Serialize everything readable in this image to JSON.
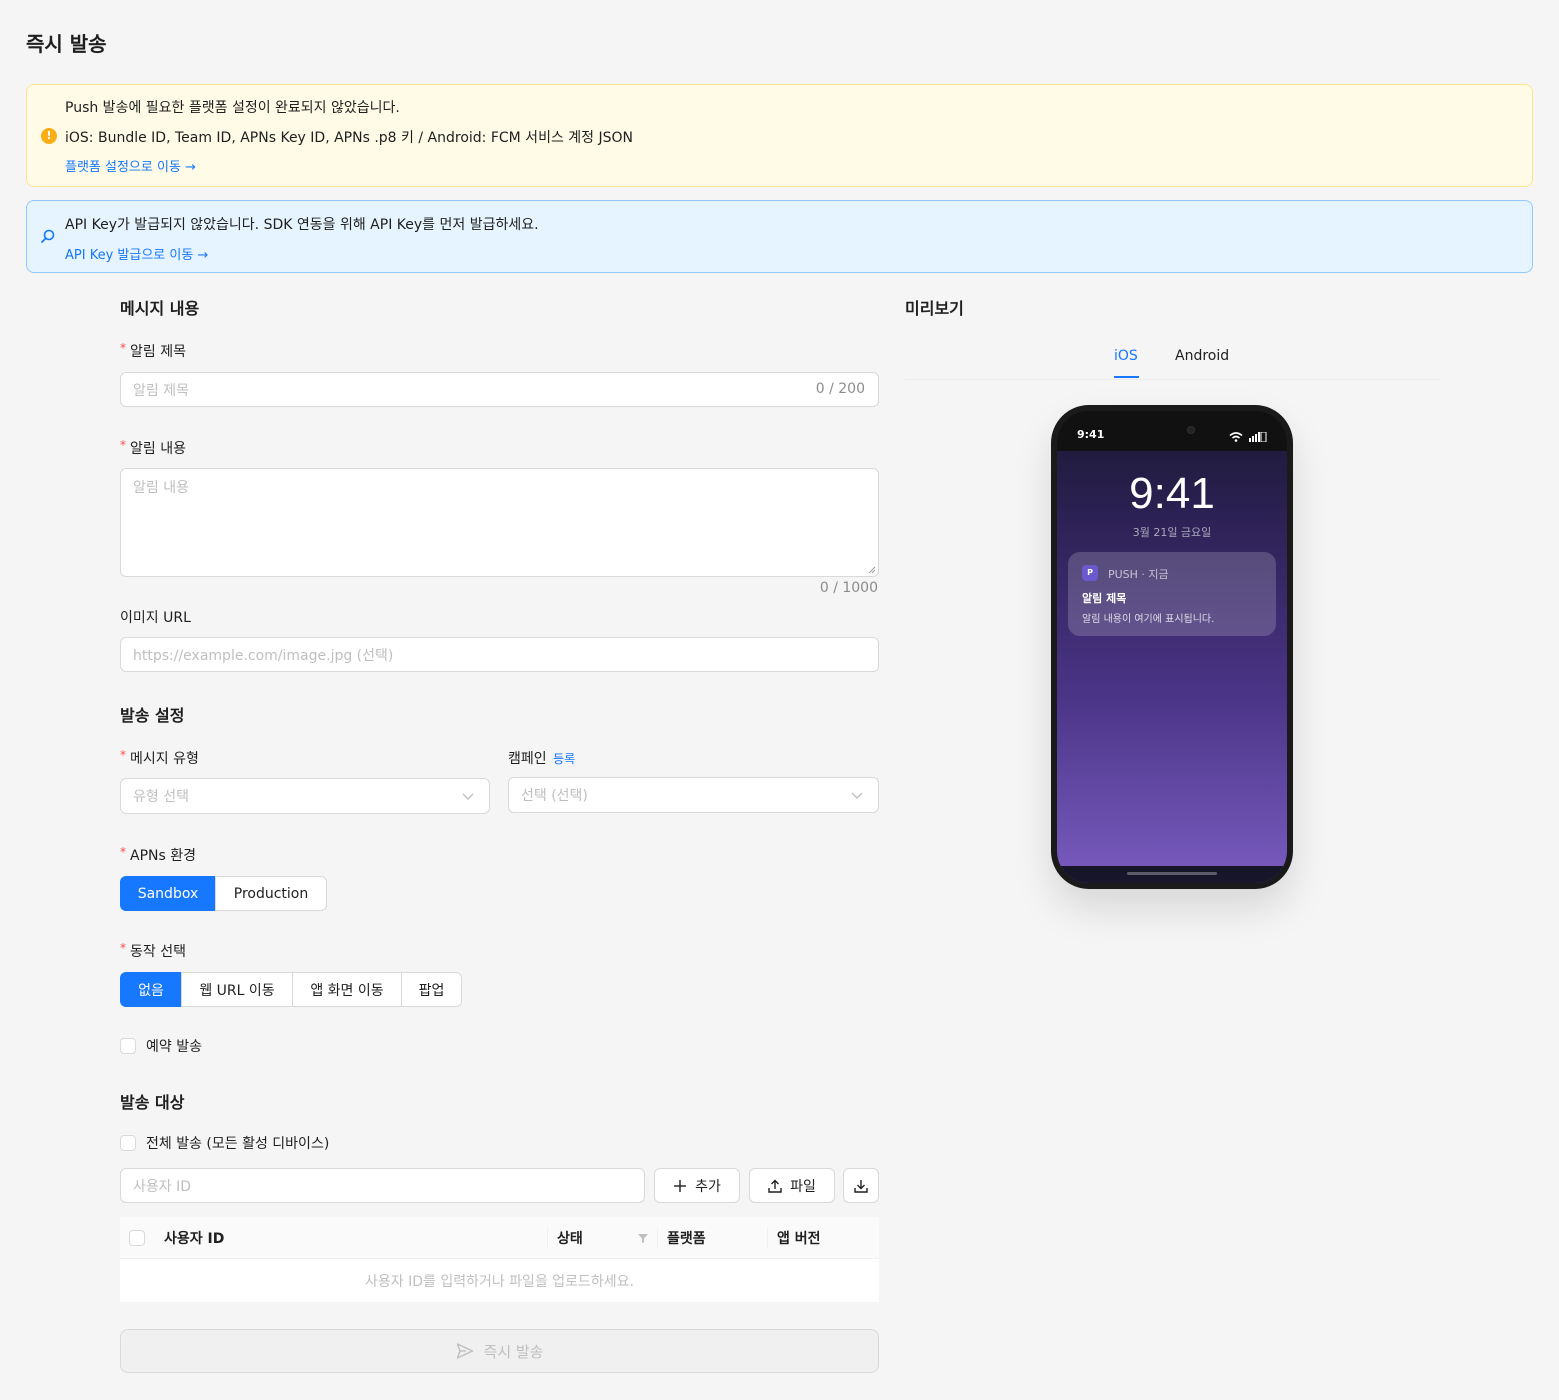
{
  "page_title": "즉시 발송",
  "alerts": {
    "platform": {
      "title": "Push 발송에 필요한 플랫폼 설정이 완료되지 않았습니다.",
      "detail": "iOS: Bundle ID, Team ID, APNs Key ID, APNs .p8 키 / Android: FCM 서비스 계정 JSON",
      "link": "플랫폼 설정으로 이동 →"
    },
    "api_key": {
      "title": "API Key가 발급되지 않았습니다. SDK 연동을 위해 API Key를 먼저 발급하세요.",
      "link": "API Key 발급으로 이동 →"
    }
  },
  "message": {
    "section_title": "메시지 내용",
    "title_label": "알림 제목",
    "title_placeholder": "알림 제목",
    "title_counter": "0 / 200",
    "body_label": "알림 내용",
    "body_placeholder": "알림 내용",
    "body_counter": "0 / 1000",
    "image_label": "이미지 URL",
    "image_placeholder": "https://example.com/image.jpg (선택)"
  },
  "settings": {
    "section_title": "발송 설정",
    "type_label": "메시지 유형",
    "type_placeholder": "유형 선택",
    "campaign_label": "캠페인",
    "campaign_link": "등록",
    "campaign_placeholder": "선택 (선택)",
    "apns_label": "APNs 환경",
    "apns_options": [
      "Sandbox",
      "Production"
    ],
    "apns_selected": "Sandbox",
    "action_label": "동작 선택",
    "action_options": [
      "없음",
      "웹 URL 이동",
      "앱 화면 이동",
      "팝업"
    ],
    "action_selected": "없음",
    "schedule_label": "예약 발송"
  },
  "target": {
    "section_title": "발송 대상",
    "all_label": "전체 발송 (모든 활성 디바이스)",
    "user_placeholder": "사용자 ID",
    "add_button": "추가",
    "file_button": "파일",
    "columns": [
      "사용자 ID",
      "상태",
      "플랫폼",
      "앱 버전"
    ],
    "empty_text": "사용자 ID를 입력하거나 파일을 업로드하세요."
  },
  "send_button": "즉시 발송",
  "preview": {
    "title": "미리보기",
    "tabs": [
      "iOS",
      "Android"
    ],
    "active_tab": "iOS",
    "status_time": "9:41",
    "lock_time": "9:41",
    "lock_date": "3월 21일 금요일",
    "app_icon_letter": "P",
    "notif_app": "PUSH · 지금",
    "notif_title": "알림 제목",
    "notif_body": "알림 내용이 여기에 표시됩니다."
  }
}
